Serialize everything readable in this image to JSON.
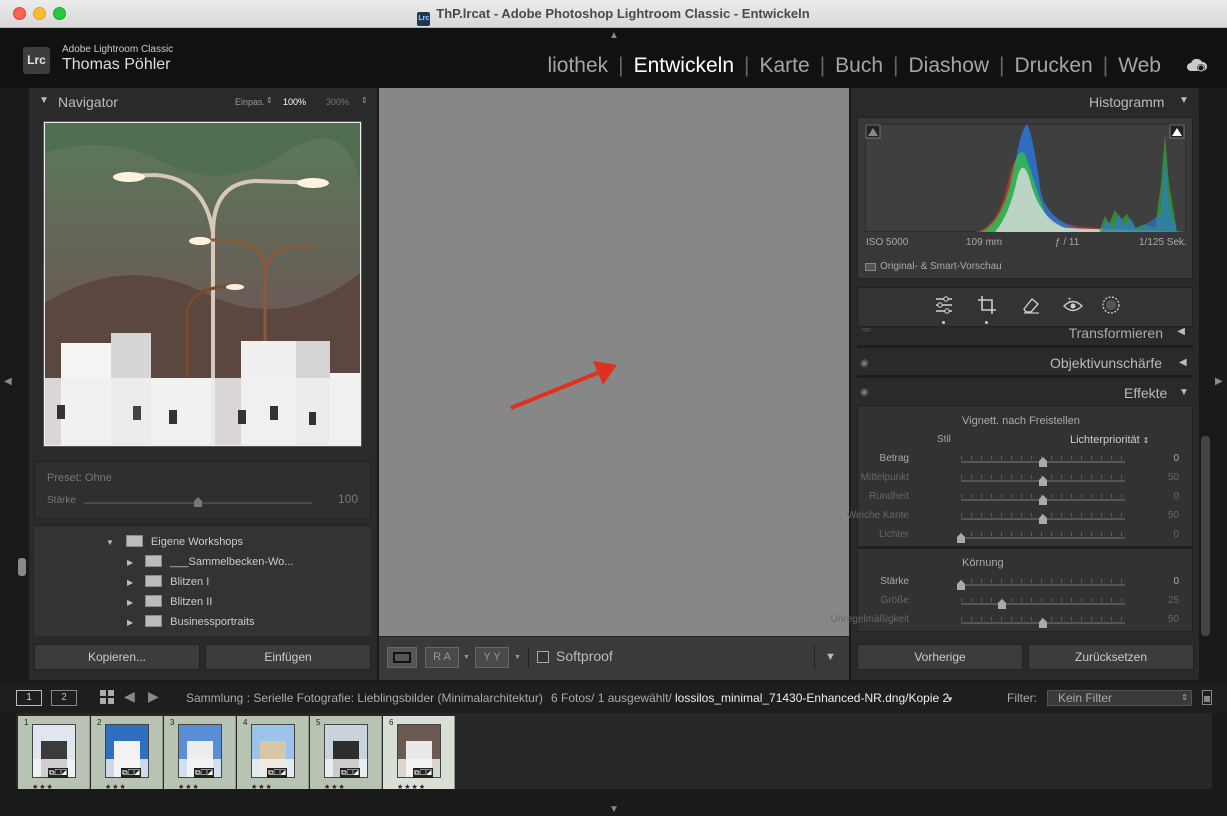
{
  "window": {
    "title": "ThP.lrcat - Adobe Photoshop Lightroom Classic - Entwickeln",
    "icon_text": "Lrc"
  },
  "identity": {
    "logo": "Lrc",
    "app_name": "Adobe Lightroom Classic",
    "user_name": "Thomas Pöhler"
  },
  "modules": [
    "liothek",
    "Entwickeln",
    "Karte",
    "Buch",
    "Diashow",
    "Drucken",
    "Web"
  ],
  "active_module": "Entwickeln",
  "navigator": {
    "title": "Navigator",
    "zoom_fit": "Einpas.",
    "zoom_100": "100%",
    "zoom_300": "300%",
    "preset_label": "Preset: Ohne",
    "strength_label": "Stärke",
    "strength_value": "100"
  },
  "folders": [
    {
      "label": "Eigene Workshops",
      "level": 0,
      "expanded": true
    },
    {
      "label": "___Sammelbecken-Wo...",
      "level": 1
    },
    {
      "label": "Blitzen I",
      "level": 1
    },
    {
      "label": "Blitzen II",
      "level": 1
    },
    {
      "label": "Businessportraits",
      "level": 1
    }
  ],
  "left_buttons": {
    "copy": "Kopieren...",
    "paste": "Einfügen"
  },
  "toolbar": {
    "softproof_label": "Softproof",
    "ra_label": "R A",
    "yy_label": "Y Y"
  },
  "histogram": {
    "title": "Histogramm",
    "iso": "ISO 5000",
    "focal": "109 mm",
    "aperture": "ƒ / 11",
    "shutter": "1/125 Sek.",
    "preview_label": "Original- & Smart-Vorschau"
  },
  "sections": {
    "transform": "Transformieren",
    "lens": "Objektivunschärfe",
    "effects": "Effekte"
  },
  "vignette": {
    "title": "Vignett. nach Freistellen",
    "style_label": "Stil",
    "style_value": "Lichterpriorität",
    "rows": [
      {
        "label": "Betrag",
        "value": "0",
        "pos": 0.5,
        "dim": false
      },
      {
        "label": "Mittelpunkt",
        "value": "50",
        "pos": 0.5,
        "dim": true
      },
      {
        "label": "Rundheit",
        "value": "0",
        "pos": 0.5,
        "dim": true
      },
      {
        "label": "Weiche Kante",
        "value": "50",
        "pos": 0.5,
        "dim": true
      },
      {
        "label": "Lichter",
        "value": "0",
        "pos": 0.0,
        "dim": true
      }
    ]
  },
  "grain": {
    "title": "Körnung",
    "rows": [
      {
        "label": "Stärke",
        "value": "0",
        "pos": 0.0,
        "dim": false
      },
      {
        "label": "Größe",
        "value": "25",
        "pos": 0.25,
        "dim": true
      },
      {
        "label": "Unregelmäßigkeit",
        "value": "50",
        "pos": 0.5,
        "dim": true
      }
    ]
  },
  "right_buttons": {
    "previous": "Vorherige",
    "reset": "Zurücksetzen"
  },
  "filmbar": {
    "view1": "1",
    "view2": "2",
    "path": "Sammlung : Serielle Fotografie: Lieblingsbilder (Minimalarchitektur)",
    "count": "6 Fotos/ 1 ausgewählt/",
    "filename": "lossilos_minimal_71430-Enhanced-NR.dng/Kopie 2",
    "filter_label": "Filter:",
    "filter_value": "Kein Filter"
  },
  "thumbnails": [
    {
      "num": "1",
      "stars": "★★★",
      "selected": false
    },
    {
      "num": "2",
      "stars": "★★★",
      "selected": false
    },
    {
      "num": "3",
      "stars": "★★★",
      "selected": false
    },
    {
      "num": "4",
      "stars": "★★★",
      "selected": false
    },
    {
      "num": "5",
      "stars": "★★★",
      "selected": false
    },
    {
      "num": "6",
      "stars": "★★★★",
      "selected": true
    }
  ],
  "colors": {
    "annotation_arrow": "#e0301e",
    "canvas": "#878787",
    "panel": "#2a2a2a"
  }
}
